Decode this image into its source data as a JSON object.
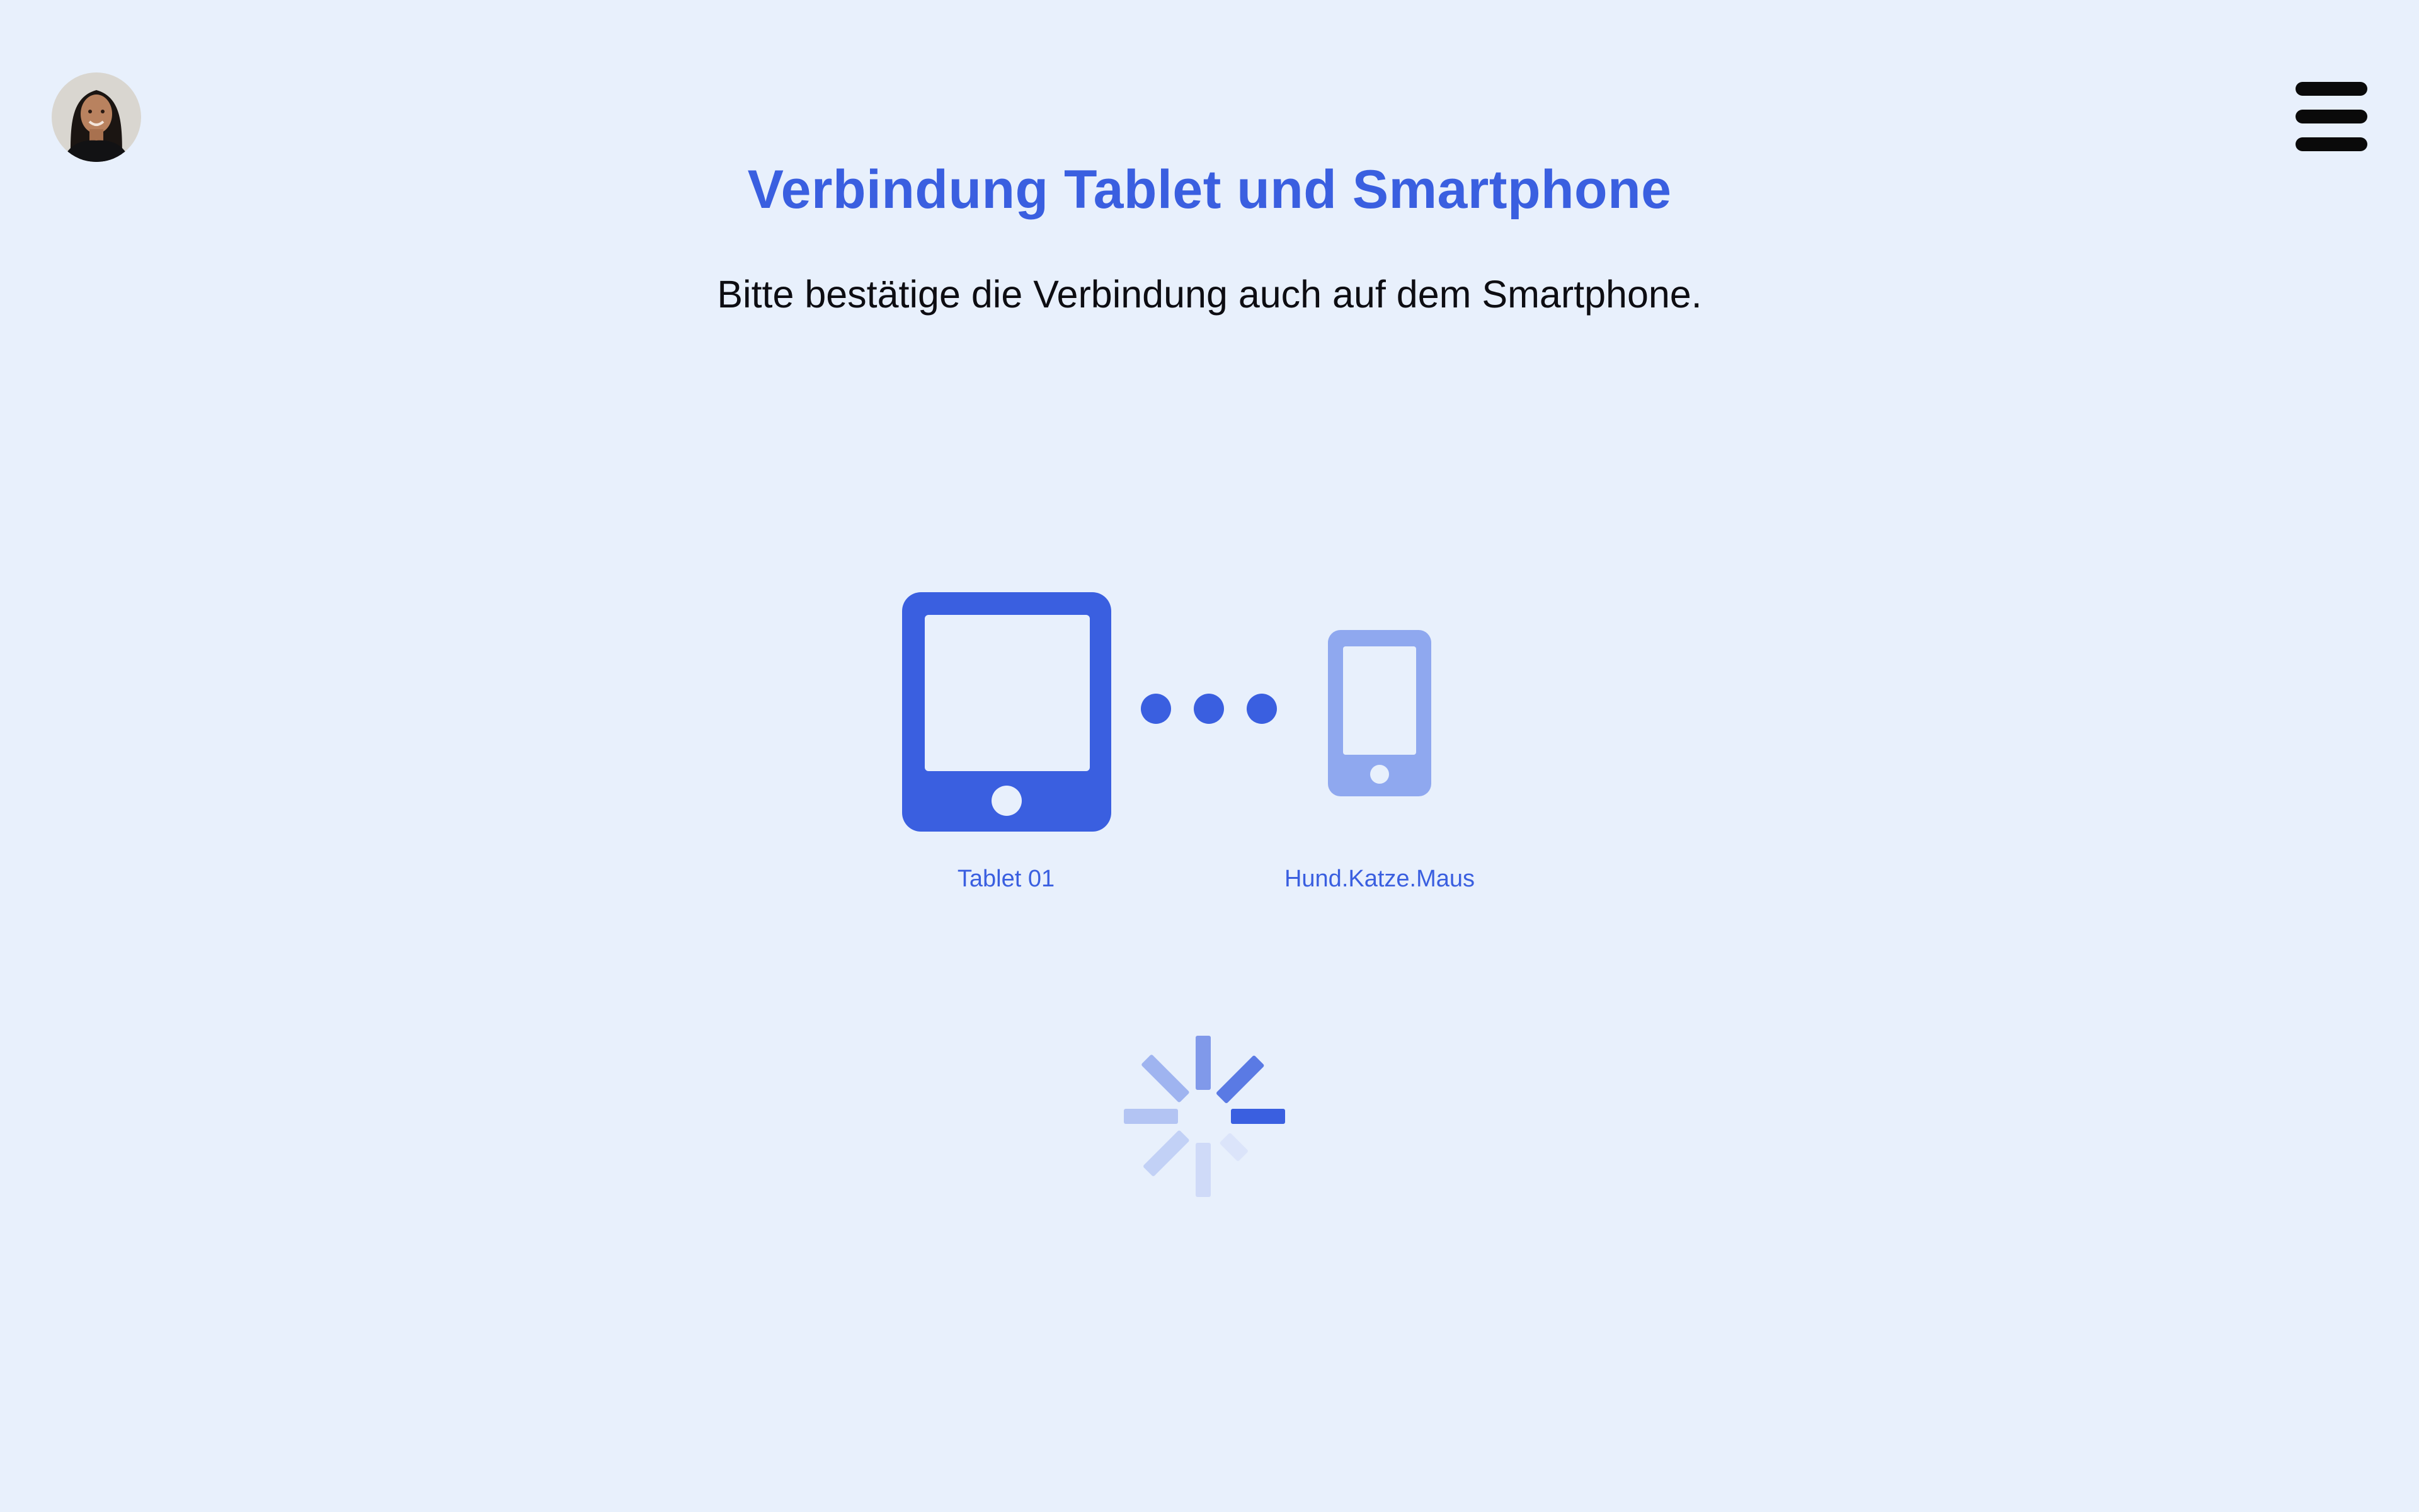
{
  "header": {
    "title": "Verbindung Tablet und Smartphone",
    "subtitle": "Bitte bestätige die Verbindung auch auf dem Smartphone."
  },
  "user": {
    "avatar_icon": "user-avatar-photo"
  },
  "menu": {
    "icon": "hamburger-menu-icon"
  },
  "connection": {
    "tablet": {
      "label": "Tablet 01",
      "icon": "tablet-icon",
      "color": "#3a5fe0"
    },
    "smartphone": {
      "label": "Hund.Katze.Maus",
      "icon": "smartphone-icon",
      "color": "#8fa8ef"
    },
    "connector_icon": "three-dots-connection-icon",
    "status_icon": "loading-spinner-icon"
  },
  "colors": {
    "background": "#e8f0fc",
    "accent": "#3a5fe0",
    "text": "#0d0d12"
  }
}
